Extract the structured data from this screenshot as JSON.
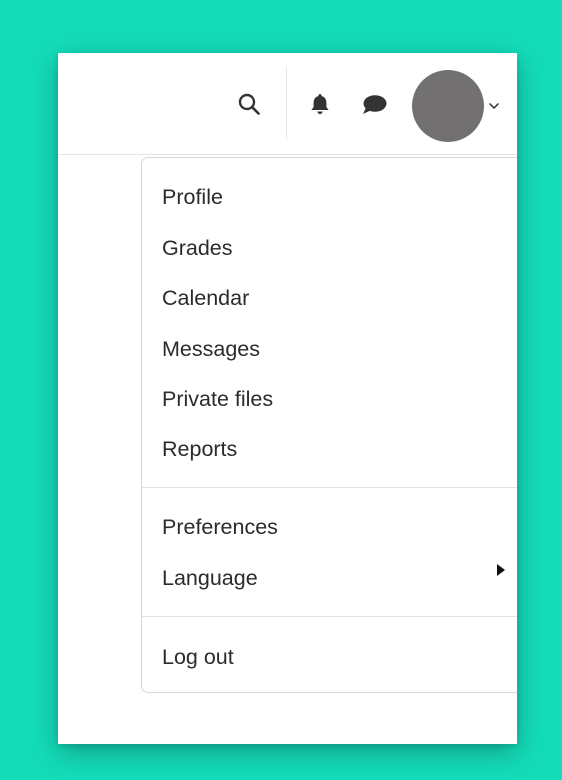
{
  "colors": {
    "background": "#14dcb9",
    "avatar": "#737071",
    "icon": "#333333",
    "text": "#2b2b2b"
  },
  "navbar": {
    "icons": [
      "search-icon",
      "bell-icon",
      "chat-icon",
      "chevron-down-icon"
    ]
  },
  "user_menu": {
    "items": [
      {
        "label": "Profile"
      },
      {
        "label": "Grades"
      },
      {
        "label": "Calendar"
      },
      {
        "label": "Messages"
      },
      {
        "label": "Private files"
      },
      {
        "label": "Reports"
      },
      {
        "label": "Preferences"
      },
      {
        "label": "Language",
        "has_submenu": true
      },
      {
        "label": "Log out"
      }
    ]
  }
}
